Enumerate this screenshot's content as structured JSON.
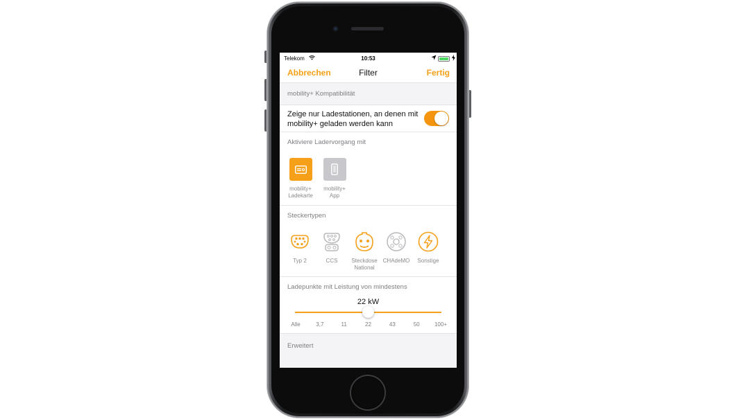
{
  "statusbar": {
    "carrier": "Telekom",
    "time": "10:53"
  },
  "navbar": {
    "cancel_label": "Abbrechen",
    "title": "Filter",
    "done_label": "Fertig"
  },
  "compatibility": {
    "header": "mobility+ Kompatibilität",
    "toggle_text": "Zeige nur Ladestationen, an denen mit mobility+ geladen werden kann",
    "toggle_on": true
  },
  "activation": {
    "header": "Aktiviere Ladervorgang mit",
    "items": [
      {
        "label_line1": "mobility+",
        "label_line2": "Ladekarte",
        "selected": true,
        "icon": "card-icon"
      },
      {
        "label_line1": "mobility+",
        "label_line2": "App",
        "selected": false,
        "icon": "phone-icon"
      }
    ]
  },
  "plugs": {
    "header": "Steckertypen",
    "items": [
      {
        "label_line1": "Typ 2",
        "label_line2": "",
        "selected": true,
        "icon": "typ2-plug-icon"
      },
      {
        "label_line1": "CCS",
        "label_line2": "",
        "selected": false,
        "icon": "ccs-plug-icon"
      },
      {
        "label_line1": "Steckdose",
        "label_line2": "National",
        "selected": true,
        "icon": "schuko-plug-icon"
      },
      {
        "label_line1": "CHAdeMO",
        "label_line2": "",
        "selected": false,
        "icon": "chademo-plug-icon"
      },
      {
        "label_line1": "Sonstige",
        "label_line2": "",
        "selected": true,
        "icon": "lightning-icon"
      }
    ]
  },
  "power": {
    "header": "Ladepunkte mit Leistung von mindestens",
    "value": "22 kW",
    "selected_index": 3,
    "ticks": [
      "Alle",
      "3,7",
      "11",
      "22",
      "43",
      "50",
      "100+"
    ]
  },
  "advanced": {
    "header": "Erweitert"
  },
  "colors": {
    "accent": "#f6a01a",
    "inactive": "#c8c8cc"
  }
}
